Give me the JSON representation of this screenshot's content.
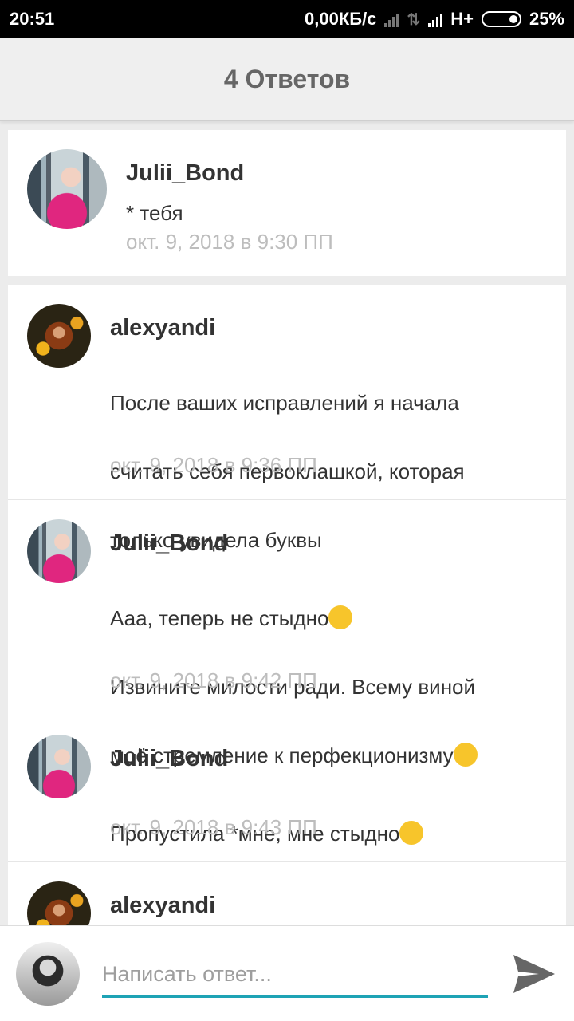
{
  "status_bar": {
    "time": "20:51",
    "speed": "0,00КБ/с",
    "network": "H+",
    "battery": "25%"
  },
  "header": {
    "title": "4 Ответов"
  },
  "parent_comment": {
    "author": "Julii_Bond",
    "text": "* тебя",
    "date": "окт. 9, 2018 в 9:30 ПП",
    "avatar": "julii-avatar"
  },
  "replies": [
    {
      "author": "alexyandi",
      "lines": [
        "После ваших исправлений я начала",
        "считать себя первоклашкой, которая",
        "только увидела буквы"
      ],
      "date": "окт. 9, 2018 в 9:36 ПП",
      "avatar": "alexyandi-avatar"
    },
    {
      "author": "Julii_Bond",
      "lines": [
        "Ааа, теперь не стыдно",
        "Извините милости ради. Всему виной",
        "моё стремление к перфекционизму"
      ],
      "emojis": [
        "flushed-emoji",
        "wink-emoji"
      ],
      "date": "окт. 9, 2018 в 9:42 ПП",
      "avatar": "julii-avatar"
    },
    {
      "author": "Julii_Bond",
      "lines": [
        "Пропустила *мне, мне стыдно"
      ],
      "emojis": [
        "thinking-emoji"
      ],
      "date": "окт. 9, 2018 в 9:43 ПП",
      "avatar": "julii-avatar"
    },
    {
      "author": "alexyandi",
      "avatar": "alexyandi-avatar"
    }
  ],
  "composer": {
    "placeholder": "Написать ответ...",
    "value": "",
    "send_icon": "send-icon",
    "accent_color": "#1ea3b5"
  }
}
